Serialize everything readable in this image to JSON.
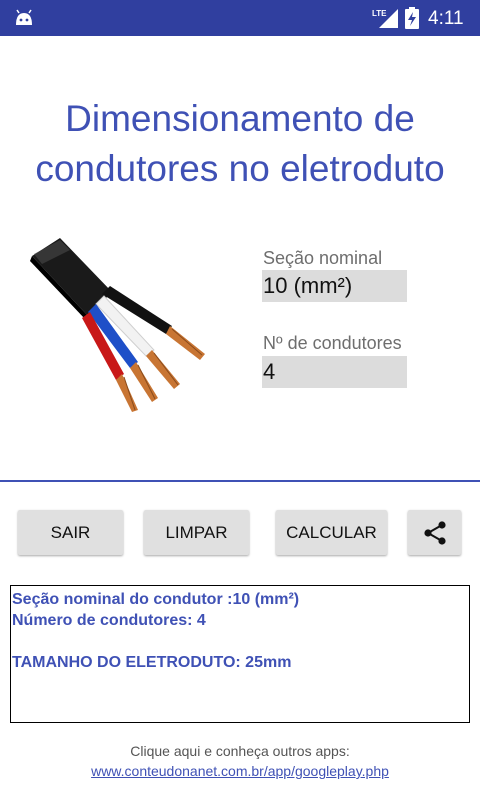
{
  "status_bar": {
    "network": "LTE",
    "time": "4:11"
  },
  "title": {
    "line1": "Dimensionamento de",
    "line2": "condutores no eletroduto"
  },
  "form": {
    "section_label": "Seção nominal",
    "section_value": "10 (mm²)",
    "count_label": "Nº de condutores",
    "count_value": "4"
  },
  "buttons": {
    "exit": "SAIR",
    "clear": "LIMPAR",
    "calculate": "CALCULAR"
  },
  "result": {
    "line1": "Seção nominal do condutor :10 (mm²)",
    "line2": "Número de condutores: 4",
    "line3": "",
    "line4": "TAMANHO DO ELETRODUTO: 25mm"
  },
  "footer": {
    "text": "Clique aqui e conheça outros apps:",
    "link": "www.conteudonanet.com.br/app/googleplay.php"
  },
  "colors": {
    "status_bar": "#303f9f",
    "accent": "#3f51b5",
    "input_bg": "#dcdcdc",
    "button_bg": "#e0e0e0"
  },
  "icons": {
    "app": "android-icon",
    "signal": "signal-icon",
    "battery": "battery-charging-icon",
    "share": "share-icon"
  }
}
